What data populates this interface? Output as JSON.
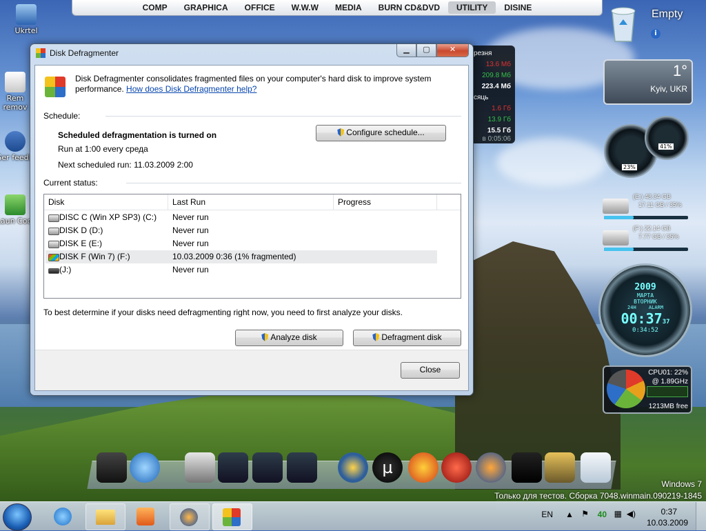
{
  "top_menu": [
    "COMP",
    "GRAPHICA",
    "OFFICE",
    "W.W.W",
    "MEDIA",
    "BURN CD&DVD",
    "UTILITY",
    "DISINE"
  ],
  "top_menu_active": "UTILITY",
  "desktop_icons": [
    {
      "label": "Ukrtel",
      "icon": "network-computer-icon"
    },
    {
      "label": "Rem remov",
      "icon": "remove-icon"
    },
    {
      "label": "Ser feedb",
      "icon": "feedback-icon"
    },
    {
      "label": "Laun Cool",
      "icon": "launcher-icon"
    }
  ],
  "gadgets": {
    "recycle_bin_label": "Empty",
    "weather": {
      "temp": "1°",
      "city": "Kyiv, UKR"
    },
    "net_meter": {
      "header1": "резня",
      "v1": "13.6 Мб",
      "v2": "209.8 Мб",
      "v3": "223.4 Мб",
      "header2": "сяць",
      "v4": "1.6 Гб",
      "v5": "13.9 Гб",
      "v6": "15.5 Гб",
      "time": "в 0:05:06"
    },
    "gauges": {
      "left_pct": "23%",
      "right_pct": "41%"
    },
    "drives": [
      {
        "label": "(E:) 48.34 GB",
        "sub": "17.11 GB / 35%",
        "pct": 35
      },
      {
        "label": "(F:) 22.14 GB",
        "sub": "7.77 GB / 35%",
        "pct": 35
      }
    ],
    "clock": {
      "year": "2009",
      "date": "МАРТА",
      "day": "ВТОРНИК",
      "mode_a": "24H",
      "mode_b": "ALARM",
      "time": "00:37",
      "secs": "37",
      "sub": "0:34:52"
    },
    "cpu": {
      "label": "CPU01:",
      "pct": "22%",
      "freq": "@ 1.89GHz",
      "mem": "1213MB free"
    }
  },
  "window": {
    "title": "Disk Defragmenter",
    "intro_text": "Disk Defragmenter consolidates fragmented files on your computer's hard disk to improve system performance.",
    "help_link": "How does Disk Defragmenter help?",
    "schedule_label": "Schedule:",
    "schedule_status": "Scheduled defragmentation is turned on",
    "schedule_run": "Run at 1:00 every среда",
    "next_run": "Next scheduled run: 11.03.2009 2:00",
    "configure_button": "Configure schedule...",
    "current_status_label": "Current status:",
    "columns": [
      "Disk",
      "Last Run",
      "Progress"
    ],
    "disks": [
      {
        "name": "DISC C (Win XP SP3) (C:)",
        "last_run": "Never run",
        "icon": "hard-drive-icon"
      },
      {
        "name": "DISK D (D:)",
        "last_run": "Never run",
        "icon": "hard-drive-icon"
      },
      {
        "name": "DISK E (E:)",
        "last_run": "Never run",
        "icon": "hard-drive-icon"
      },
      {
        "name": "DISK F (Win 7) (F:)",
        "last_run": "10.03.2009 0:36 (1% fragmented)",
        "icon": "windows-drive-icon"
      },
      {
        "name": "(J:)",
        "last_run": "Never run",
        "icon": "removable-drive-icon"
      }
    ],
    "selected_disk_index": 3,
    "hint": "To best determine if your disks need defragmenting right now, you need to first analyze your disks.",
    "analyze_button": "Analyze disk",
    "defragment_button": "Defragment disk",
    "close_button": "Close"
  },
  "watermark": {
    "line1": "Windows 7",
    "line2": "Только для тестов. Сборка 7048.winmain.090219-1845"
  },
  "taskbar": {
    "language": "EN",
    "battery": "40",
    "time": "0:37",
    "date": "10.03.2009",
    "buttons": [
      "start-button",
      "internet-explorer-icon",
      "explorer-icon",
      "media-player-icon",
      "firefox-icon",
      "disk-defragmenter-icon"
    ]
  },
  "colors": {
    "accent": "#2a64c8",
    "link": "#0645ad",
    "selected_row": "#e9eaec",
    "drive_bar": "#47c3ef"
  }
}
